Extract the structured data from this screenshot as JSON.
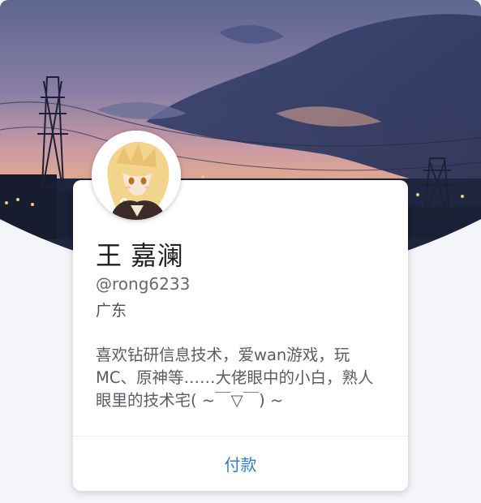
{
  "profile": {
    "name": "王 嘉澜",
    "handle": "@rong6233",
    "location": "广东",
    "bio": "喜欢钻研信息技术，爱wan游戏，玩MC、原神等……大佬眼中的小白，熟人眼里的技术宅( ~￣▽￣) ~"
  },
  "actions": {
    "pay_label": "付款"
  },
  "colors": {
    "accent": "#2e7fc7",
    "card_bg": "#ffffff",
    "page_bg": "#f4f5f8"
  }
}
